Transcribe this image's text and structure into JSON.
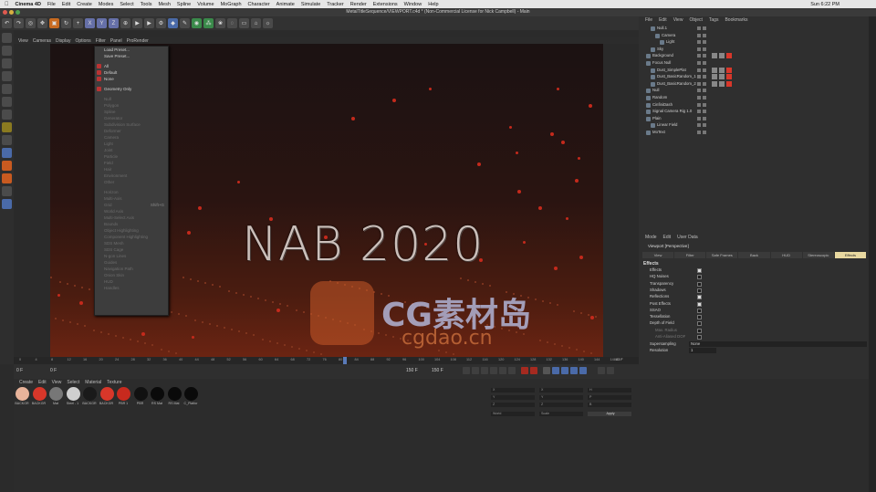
{
  "macbar": {
    "app": "Cinema 4D",
    "menus": [
      "File",
      "Edit",
      "Create",
      "Modes",
      "Select",
      "Tools",
      "Mesh",
      "Spline",
      "Volume",
      "MoGraph",
      "Character",
      "Animate",
      "Simulate",
      "Tracker",
      "Render",
      "Extensions",
      "Window",
      "Help"
    ],
    "clock": "Sun 6:22 PM"
  },
  "window": {
    "title": "MetalTitleSequence/VIEWPORT.c4d * (Non-Commercial License for Nick Campbell) - Main"
  },
  "viewport_menu": {
    "row1": [
      "View",
      "Picture Viewer",
      "Render Settings"
    ],
    "row2": [
      "View",
      "Cameras",
      "Display",
      "Options",
      "Filter",
      "Panel",
      "ProRender"
    ]
  },
  "scene_text": "NAB 2020",
  "watermark": {
    "text": "CG素材岛",
    "sub": "cgdao.cn"
  },
  "dropdown": {
    "items": [
      {
        "label": "Load Preset...",
        "disabled": false,
        "check": false
      },
      {
        "label": "Save Preset...",
        "disabled": false,
        "check": false
      },
      {
        "sep": true
      },
      {
        "label": "All",
        "disabled": false,
        "check": true
      },
      {
        "label": "Default",
        "disabled": false,
        "check": true
      },
      {
        "label": "None",
        "disabled": false,
        "check": true
      },
      {
        "sep": true
      },
      {
        "label": "Geometry Only",
        "disabled": false,
        "check": true
      },
      {
        "sep": true
      },
      {
        "label": "Null",
        "disabled": true
      },
      {
        "label": "Polygon",
        "disabled": true
      },
      {
        "label": "Spline",
        "disabled": true
      },
      {
        "label": "Generator",
        "disabled": true
      },
      {
        "label": "Subdivision Surface",
        "disabled": true
      },
      {
        "label": "Deformer",
        "disabled": true
      },
      {
        "label": "Camera",
        "disabled": true
      },
      {
        "label": "Light",
        "disabled": true
      },
      {
        "label": "Joint",
        "disabled": true
      },
      {
        "label": "Particle",
        "disabled": true
      },
      {
        "label": "Field",
        "disabled": true
      },
      {
        "label": "Hair",
        "disabled": true
      },
      {
        "label": "Environment",
        "disabled": true
      },
      {
        "label": "Other",
        "disabled": true
      },
      {
        "sep": true
      },
      {
        "label": "Horizon",
        "disabled": true
      },
      {
        "label": "Multi-Axis",
        "disabled": true
      },
      {
        "label": "Grid",
        "disabled": true,
        "shortcut": "Shift+G"
      },
      {
        "label": "World Axis",
        "disabled": true
      },
      {
        "label": "Multi-Select Axis",
        "disabled": true
      },
      {
        "label": "Bounds",
        "disabled": true
      },
      {
        "label": "Object Highlighting",
        "disabled": true
      },
      {
        "label": "Component Highlighting",
        "disabled": true
      },
      {
        "label": "SDS Mesh",
        "disabled": true
      },
      {
        "label": "SDS Cage",
        "disabled": true
      },
      {
        "label": "N-gon Lines",
        "disabled": true
      },
      {
        "label": "Guides",
        "disabled": true
      },
      {
        "label": "Navigation Path",
        "disabled": true
      },
      {
        "label": "Onion Skin",
        "disabled": true
      },
      {
        "label": "HUD",
        "disabled": true
      },
      {
        "label": "Handles",
        "disabled": true
      }
    ]
  },
  "timeline": {
    "ticks": [
      "0",
      "4",
      "8",
      "12",
      "16",
      "20",
      "24",
      "28",
      "32",
      "36",
      "40",
      "44",
      "48",
      "52",
      "56",
      "60",
      "64",
      "68",
      "72",
      "76",
      "80",
      "84",
      "88",
      "92",
      "96",
      "100",
      "104",
      "108",
      "112",
      "116",
      "120",
      "124",
      "128",
      "132",
      "136",
      "140",
      "144",
      "148"
    ],
    "current": "83 F",
    "start": "0 F",
    "start2": "0 F",
    "end": "150 F",
    "end2": "150 F"
  },
  "materials": {
    "menu": [
      "Create",
      "Edit",
      "View",
      "Select",
      "Material",
      "Texture"
    ],
    "items": [
      {
        "label": "BACKGR",
        "color": "#e8b39a"
      },
      {
        "label": "BACKGR",
        "color": "#d8372a"
      },
      {
        "label": "Mat",
        "color": "#777777"
      },
      {
        "label": "Steel - 1",
        "color": "#cfcfcf"
      },
      {
        "label": "BACKGR",
        "color": "#1a1a1a"
      },
      {
        "label": "BACKGR",
        "color": "#d8372a"
      },
      {
        "label": "PBR 1",
        "color": "#c82a1e"
      },
      {
        "label": "PBR",
        "color": "#111111"
      },
      {
        "label": "RS Mat",
        "color": "#0a0a0a"
      },
      {
        "label": "RS Mat",
        "color": "#0a0a0a"
      },
      {
        "label": "C_Platfor",
        "color": "#0a0a0a"
      }
    ]
  },
  "coords": {
    "rows": [
      "X",
      "Y",
      "Z"
    ],
    "mode1": "World",
    "mode2": "Scale",
    "apply": "Apply"
  },
  "object_manager": {
    "menu": [
      "File",
      "Edit",
      "View",
      "Object",
      "Tags",
      "Bookmarks"
    ],
    "objects": [
      {
        "name": "Null.1",
        "indent": 1
      },
      {
        "name": "Camera",
        "indent": 2
      },
      {
        "name": "Light",
        "indent": 3
      },
      {
        "name": "Sky",
        "indent": 1
      },
      {
        "name": "Background",
        "indent": 0
      },
      {
        "name": "Focus Null",
        "indent": 0
      },
      {
        "name": "Dust_SimplePlat",
        "indent": 1
      },
      {
        "name": "Dust_BasicRandom_1",
        "indent": 1
      },
      {
        "name": "Dust_BasicRandom_2",
        "indent": 1
      },
      {
        "name": "Null",
        "indent": 0
      },
      {
        "name": "Random",
        "indent": 0
      },
      {
        "name": "CinfiniDash",
        "indent": 0
      },
      {
        "name": "Signal Camera Rig 1.0",
        "indent": 0
      },
      {
        "name": "Plain",
        "indent": 0
      },
      {
        "name": "Linear Field",
        "indent": 1
      },
      {
        "name": "MoText",
        "indent": 0
      }
    ]
  },
  "attributes": {
    "menu": [
      "Mode",
      "Edit",
      "User Data"
    ],
    "title": "Viewport [Perspective]",
    "tabs": [
      "View",
      "Filter",
      "Safe Frames",
      "Back",
      "HUD",
      "Stereoscopic",
      "Effects"
    ],
    "section": "Effects",
    "rows": [
      {
        "label": "Effects",
        "on": true
      },
      {
        "label": "HQ Noises",
        "on": false
      },
      {
        "label": "Transparency",
        "on": false
      },
      {
        "label": "Shadows",
        "on": false
      },
      {
        "label": "Reflections",
        "on": true
      },
      {
        "label": "Post Effects",
        "on": true
      },
      {
        "label": "SSAO",
        "on": false
      },
      {
        "label": "Tessellation",
        "on": false
      },
      {
        "label": "Depth of Field",
        "on": false
      },
      {
        "label": "Max. Radius",
        "on": false
      },
      {
        "label": "Anti-Aliased DOF",
        "on": false
      }
    ],
    "supersampling_label": "Supersampling",
    "supersampling_value": "None",
    "resolution_label": "Resolution",
    "resolution_value": "1"
  },
  "colors": {
    "accent": "#c42a1c",
    "active_tab": "#e8d8a0"
  }
}
